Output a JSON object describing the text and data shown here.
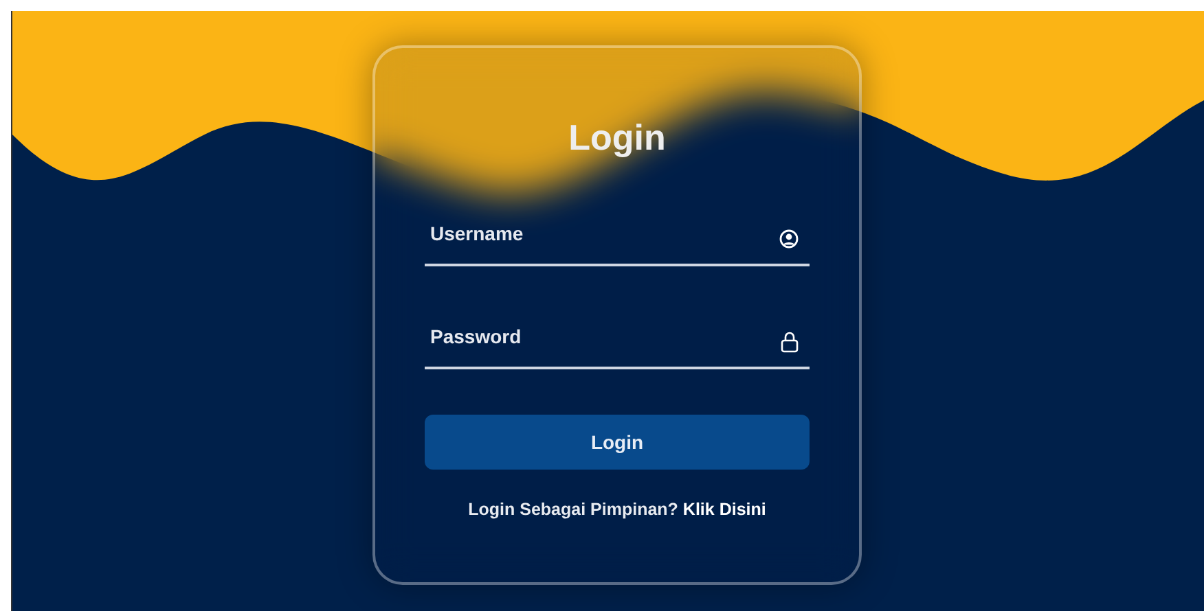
{
  "title": "Login",
  "fields": [
    {
      "placeholder": "Username",
      "kind": "user"
    },
    {
      "placeholder": "Password",
      "kind": "lock"
    }
  ],
  "button": "Login",
  "footer": {
    "prompt": "Login Sebagai Pimpinan?",
    "link": "Klik Disini"
  }
}
